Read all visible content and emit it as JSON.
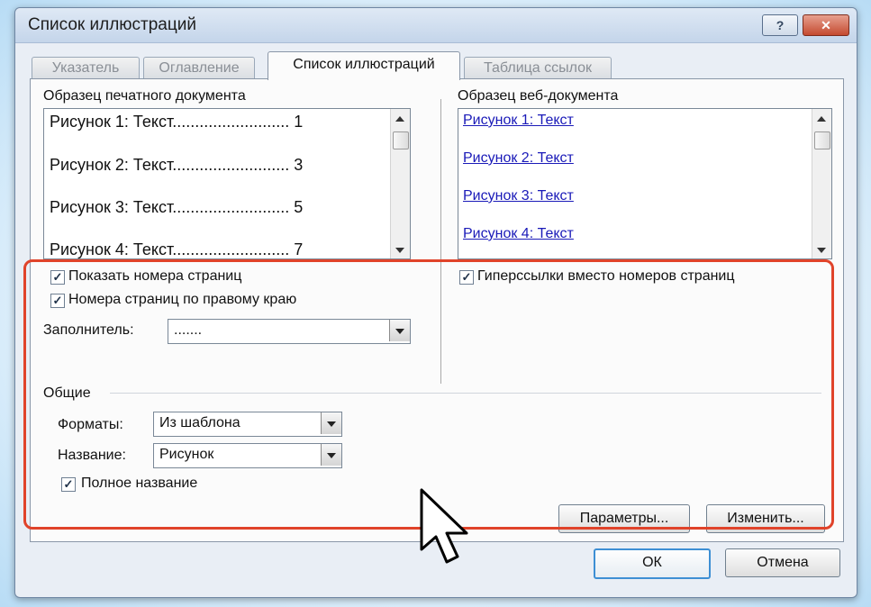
{
  "window": {
    "title": "Список иллюстраций",
    "help_label": "?",
    "close_label": "✕"
  },
  "tabs": [
    {
      "label": "Указатель",
      "active": false
    },
    {
      "label": "Оглавление",
      "active": false
    },
    {
      "label": "Список иллюстраций",
      "active": true
    },
    {
      "label": "Таблица ссылок",
      "active": false
    }
  ],
  "print_preview": {
    "label": "Образец печатного документа",
    "lines": [
      "Рисунок 1: Текст.......................... 1",
      "Рисунок 2: Текст.......................... 3",
      "Рисунок 3: Текст.......................... 5",
      "Рисунок 4: Текст.......................... 7"
    ]
  },
  "web_preview": {
    "label": "Образец веб-документа",
    "links": [
      "Рисунок 1: Текст",
      "Рисунок 2: Текст",
      "Рисунок 3: Текст",
      "Рисунок 4: Текст"
    ]
  },
  "options": {
    "show_page_numbers": {
      "label": "Показать номера страниц",
      "checked": true
    },
    "right_align": {
      "label": "Номера страниц по правому краю",
      "checked": true
    },
    "tab_leader": {
      "label": "Заполнитель:",
      "value": "......."
    },
    "hyperlinks": {
      "label": "Гиперссылки вместо номеров страниц",
      "checked": true
    }
  },
  "general": {
    "heading": "Общие",
    "formats": {
      "label": "Форматы:",
      "value": "Из шаблона"
    },
    "caption": {
      "label": "Название:",
      "value": "Рисунок"
    },
    "full_caption": {
      "label": "Полное название",
      "checked": true
    }
  },
  "buttons": {
    "options": "Параметры...",
    "modify": "Изменить...",
    "ok": "ОК",
    "cancel": "Отмена"
  },
  "colors": {
    "highlight": "#e0432a",
    "link": "#1a1ab8",
    "default_button": "#3d8fd4"
  }
}
